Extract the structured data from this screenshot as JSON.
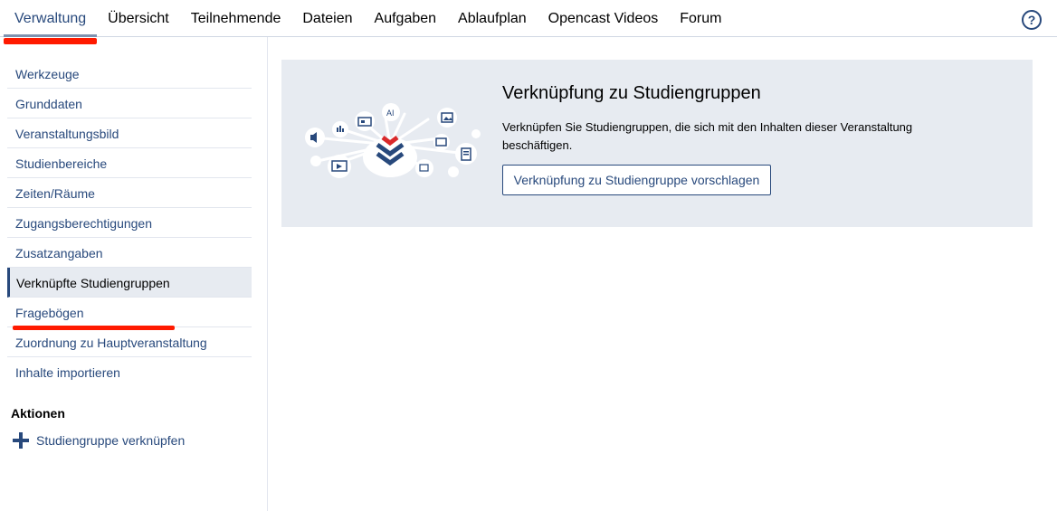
{
  "topnav": {
    "tabs": [
      {
        "label": "Verwaltung",
        "active": true
      },
      {
        "label": "Übersicht"
      },
      {
        "label": "Teilnehmende"
      },
      {
        "label": "Dateien"
      },
      {
        "label": "Aufgaben"
      },
      {
        "label": "Ablaufplan"
      },
      {
        "label": "Opencast Videos"
      },
      {
        "label": "Forum"
      }
    ],
    "help_icon": "question-circle-icon",
    "help_glyph": "?"
  },
  "sidebar": {
    "items": [
      {
        "label": "Werkzeuge"
      },
      {
        "label": "Grunddaten"
      },
      {
        "label": "Veranstaltungsbild"
      },
      {
        "label": "Studienbereiche"
      },
      {
        "label": "Zeiten/Räume"
      },
      {
        "label": "Zugangsberechtigungen"
      },
      {
        "label": "Zusatzangaben"
      },
      {
        "label": "Verknüpfte Studiengruppen",
        "active": true
      },
      {
        "label": "Fragebögen"
      },
      {
        "label": "Zuordnung zu Hauptveranstaltung"
      },
      {
        "label": "Inhalte importieren"
      }
    ],
    "actions_title": "Aktionen",
    "action_label": "Studiengruppe verknüpfen",
    "action_icon": "plus-icon"
  },
  "banner": {
    "title": "Verknüpfung zu Studiengruppen",
    "text": "Verknüpfen Sie Studiengruppen, die sich mit den Inhalten dieser Veranstaltung beschäftigen.",
    "button_label": "Verknüpfung zu Studiengruppe vorschlagen",
    "illustration_icon": "content-network-icon",
    "illustration_glyph": "AI"
  },
  "colors": {
    "brand": "#28497c",
    "banner_bg": "#e7ebf1",
    "annotation_red": "#ff1a00",
    "logo_red": "#d9292b"
  }
}
